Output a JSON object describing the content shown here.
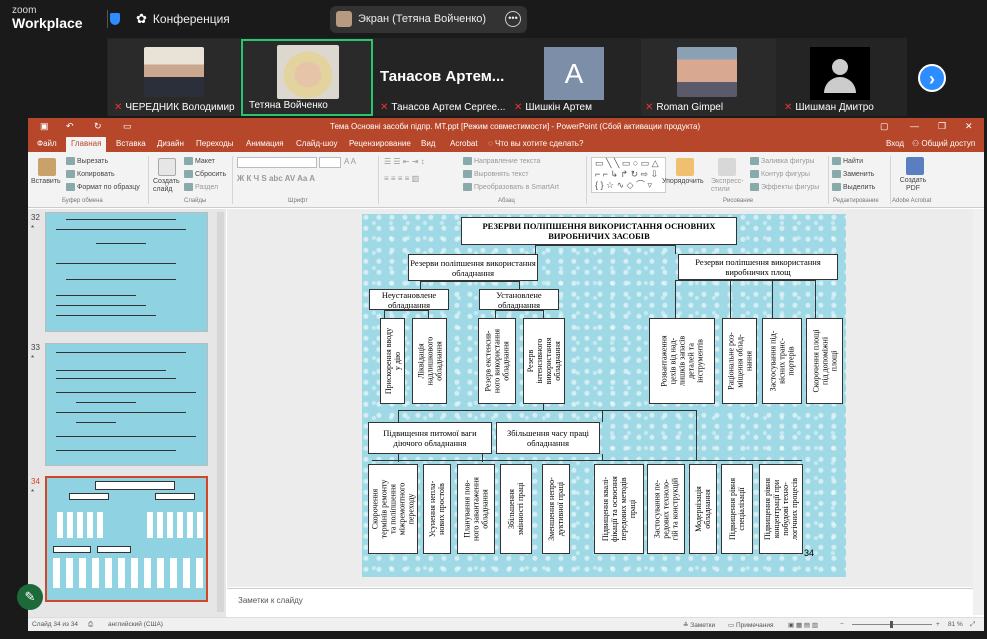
{
  "zoom": {
    "logo_small": "zoom",
    "logo_big": "Workplace",
    "conference": "Конференция",
    "screen_label": "Экран (Тетяна Войченко)"
  },
  "participants": [
    {
      "name": "ЧЕРЕДНИК Володимир",
      "muted": true
    },
    {
      "name": "Тетяна Войченко",
      "muted": false
    },
    {
      "name": "Танасов Артем Сергее...",
      "muted": true
    },
    {
      "name": "Шишкін Артем",
      "muted": true
    },
    {
      "name": "Roman Gimpel",
      "muted": true
    },
    {
      "name": "Шишман Дмитро",
      "muted": true
    }
  ],
  "big_name": "Танасов Артем...",
  "avatar_letter": "A",
  "ppt": {
    "title": "Тема Основні засоби підпр. МТ.ppt [Режим совместимости] - PowerPoint (Сбой активации продукта)",
    "tabs": [
      "Файл",
      "Главная",
      "Вставка",
      "Дизайн",
      "Переходы",
      "Анимация",
      "Слайд-шоу",
      "Рецензирование",
      "Вид",
      "Acrobat"
    ],
    "tell_me": "Что вы хотите сделать?",
    "login": "Вход",
    "share": "Общий доступ",
    "ribbon": {
      "paste": "Вставить",
      "cut": "Вырезать",
      "copy": "Копировать",
      "format": "Формат по образцу",
      "clipboard": "Буфер обмена",
      "new_slide": "Создать слайд",
      "layout": "Макет",
      "reset": "Сбросить",
      "section": "Раздел",
      "slides": "Слайды",
      "font": "Шрифт",
      "text_dir": "Направление текста",
      "align_text": "Выровнять текст",
      "smartart": "Преобразовать в SmartArt",
      "paragraph": "Абзац",
      "arrange": "Упорядочить",
      "quick": "Экспресс-стили",
      "fill": "Заливка фигуры",
      "outline": "Контур фигуры",
      "effects": "Эффекты фигуры",
      "drawing": "Рисование",
      "find": "Найти",
      "replace": "Заменить",
      "select": "Выделить",
      "editing": "Редактирование",
      "create_pdf": "Создать PDF",
      "acrobat": "Adobe Acrobat"
    },
    "thumb_numbers": [
      "32",
      "33",
      "34"
    ],
    "notes": "Заметки к слайду",
    "status": {
      "slide": "Слайд 34 из 34",
      "lang": "английский (США)",
      "notes": "Заметки",
      "comments": "Примечания",
      "zoom": "81 %"
    }
  },
  "slide": {
    "title": "РЕЗЕРВИ ПОЛІПШЕННЯ ВИКОРИСТАННЯ ОСНОВНИХ ВИРОБНИЧИХ ЗАСОБІВ",
    "left_head": "Резерви поліпшення використання обладнання",
    "right_head": "Резерви поліпшення використання виробничих площ",
    "uninstalled": "Неустановлене обладнання",
    "installed": "Установлене обладнання",
    "v1": "Прискорення вводу\nу дію",
    "v2": "Ліквідація\nнадлишкового\nобладнання",
    "v3": "Резерв екстенсив-\nного використання\nобладнання",
    "v4": "Резерв\nінтенсивного\nвикористання\nобладнання",
    "r1": "Розвантаження\nцехів від над-\nлишків запасів\nдеталей та\nінструментів",
    "r2": "Раціональне роз-\nміщення облад-\nнання",
    "r3": "Застосування під-\nвісних транс-\nпортерів",
    "r4": "Скорочення площі\nпід допоміжні\nплощі",
    "shift": "Підвищення питомої ваги діючого обладнання",
    "time": "Збільшення часу праці обладнання",
    "b1": "Скорочення\nтермінів ремонту\nта поліпшення\nміжремонтного\nпереходу",
    "b2": "Усунення непла-\nнових простоїв",
    "b3": "Планування пов-\nного завантаження\nобладнання",
    "b4": "Збільшення\nзмінності праці",
    "b5": "Зменшення непро-\nдуктивної праці",
    "b6": "Підвищення квалі-\nфікації та освоєння\nпередових методів\nпраці",
    "b7": "Застосування пе-\nредових техноло-\nгій та конструкцій",
    "b8": "Модернізація\nобладнання",
    "b9": "Підвищення рівня\nспеціалізації",
    "b10": "Підвищення рівня\nконцентрації при\nпобудові техно-\nлогічних процесів",
    "number": "34"
  },
  "colors": {
    "ppt_accent": "#b7472a",
    "zoom_blue": "#2d8cff",
    "slide_bg": "#9fd9e6"
  }
}
